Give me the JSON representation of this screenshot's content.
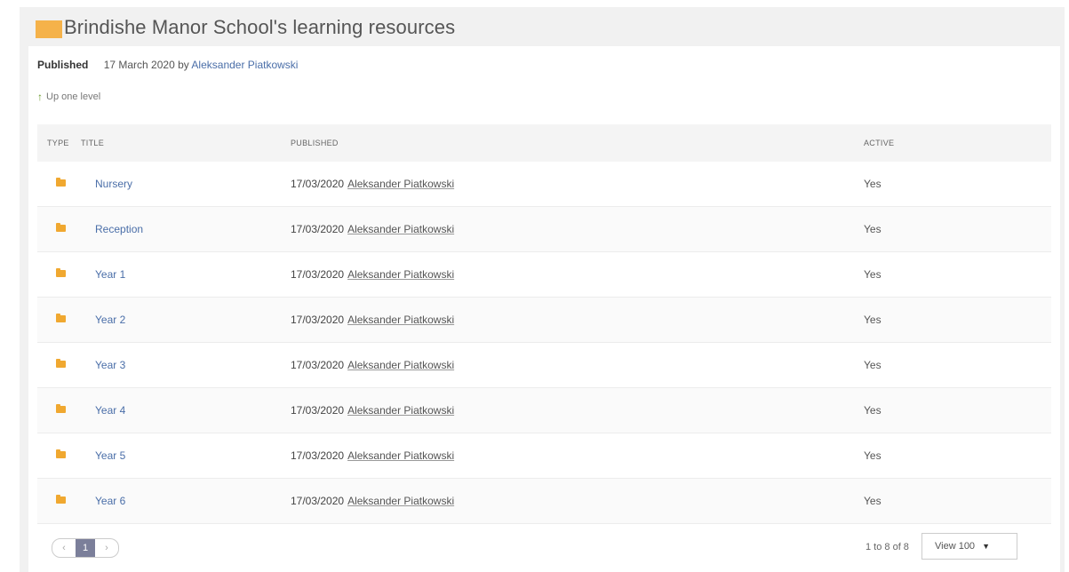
{
  "page": {
    "title": "Brindishe Manor School's learning resources",
    "published_label": "Published",
    "published_date": "17 March 2020 by",
    "published_author": "Aleksander Piatkowski",
    "up_level": "Up one level"
  },
  "table": {
    "headers": {
      "type": "TYPE",
      "title": "TITLE",
      "published": "PUBLISHED",
      "active": "ACTIVE"
    },
    "rows": [
      {
        "title": "Nursery",
        "date": "17/03/2020",
        "author": "Aleksander Piatkowski",
        "active": "Yes"
      },
      {
        "title": "Reception",
        "date": "17/03/2020",
        "author": "Aleksander Piatkowski",
        "active": "Yes"
      },
      {
        "title": "Year 1",
        "date": "17/03/2020",
        "author": "Aleksander Piatkowski",
        "active": "Yes"
      },
      {
        "title": "Year 2",
        "date": "17/03/2020",
        "author": "Aleksander Piatkowski",
        "active": "Yes"
      },
      {
        "title": "Year 3",
        "date": "17/03/2020",
        "author": "Aleksander Piatkowski",
        "active": "Yes"
      },
      {
        "title": "Year 4",
        "date": "17/03/2020",
        "author": "Aleksander Piatkowski",
        "active": "Yes"
      },
      {
        "title": "Year 5",
        "date": "17/03/2020",
        "author": "Aleksander Piatkowski",
        "active": "Yes"
      },
      {
        "title": "Year 6",
        "date": "17/03/2020",
        "author": "Aleksander Piatkowski",
        "active": "Yes"
      }
    ]
  },
  "footer": {
    "prev": "‹",
    "page": "1",
    "next": "›",
    "range": "1 to 8 of 8",
    "view": "View 100"
  },
  "icons": {
    "row_icon": "folder-icon",
    "up_icon": "up-arrow-icon"
  },
  "colors": {
    "folder": "#f0a830",
    "link": "#4a6ea8",
    "pager_active": "#7b7f9a"
  }
}
